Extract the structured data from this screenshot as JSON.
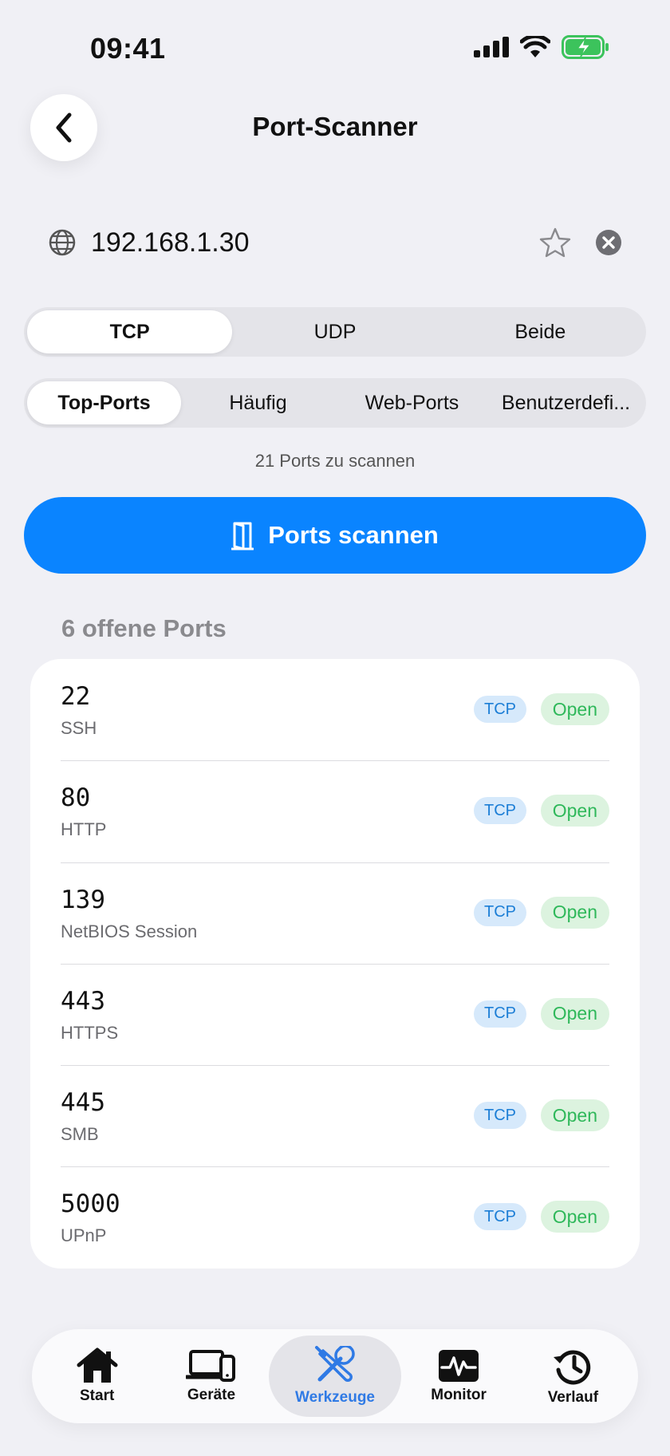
{
  "status_bar": {
    "time": "09:41"
  },
  "nav": {
    "title": "Port-Scanner"
  },
  "address": {
    "value": "192.168.1.30"
  },
  "protocol_tabs": [
    {
      "label": "TCP",
      "active": true
    },
    {
      "label": "UDP",
      "active": false
    },
    {
      "label": "Beide",
      "active": false
    }
  ],
  "preset_tabs": [
    {
      "label": "Top-Ports",
      "active": true
    },
    {
      "label": "Häufig",
      "active": false
    },
    {
      "label": "Web-Ports",
      "active": false
    },
    {
      "label": "Benutzerdefi...",
      "active": false
    }
  ],
  "port_count_text": "21 Ports zu scannen",
  "scan_button": {
    "label": "Ports scannen",
    "color": "#0a84ff"
  },
  "results": {
    "header": "6 offene Ports",
    "ports": [
      {
        "number": "22",
        "service": "SSH",
        "protocol": "TCP",
        "state": "Open"
      },
      {
        "number": "80",
        "service": "HTTP",
        "protocol": "TCP",
        "state": "Open"
      },
      {
        "number": "139",
        "service": "NetBIOS Session",
        "protocol": "TCP",
        "state": "Open"
      },
      {
        "number": "443",
        "service": "HTTPS",
        "protocol": "TCP",
        "state": "Open"
      },
      {
        "number": "445",
        "service": "SMB",
        "protocol": "TCP",
        "state": "Open"
      },
      {
        "number": "5000",
        "service": "UPnP",
        "protocol": "TCP",
        "state": "Open"
      }
    ]
  },
  "tab_bar": [
    {
      "label": "Start",
      "icon": "house-icon",
      "active": false
    },
    {
      "label": "Geräte",
      "icon": "devices-icon",
      "active": false
    },
    {
      "label": "Werkzeuge",
      "icon": "tools-icon",
      "active": true
    },
    {
      "label": "Monitor",
      "icon": "monitor-icon",
      "active": false
    },
    {
      "label": "Verlauf",
      "icon": "history-icon",
      "active": false
    }
  ],
  "colors": {
    "accent": "#0a84ff",
    "open_green": "#2fb85a",
    "tcp_blue": "#1c7ed6",
    "active_tab": "#2f7ae5"
  }
}
